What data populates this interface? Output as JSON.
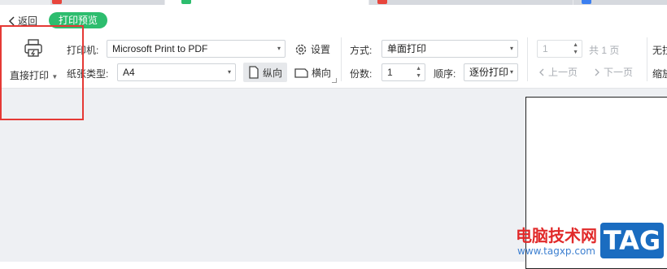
{
  "nav": {
    "back_label": "返回",
    "badge_label": "打印预览"
  },
  "ribbon": {
    "direct_print_label": "直接打印",
    "printer_label": "打印机:",
    "printer_value": "Microsoft Print to PDF",
    "settings_label": "设置",
    "paper_type_label": "纸张类型:",
    "paper_type_value": "A4",
    "portrait_label": "纵向",
    "landscape_label": "横向",
    "mode_label": "方式:",
    "mode_value": "单面打印",
    "copies_label": "份数:",
    "copies_value": "1",
    "order_label": "顺序:",
    "order_value": "逐份打印",
    "page_value": "1",
    "total_pages_label": "共 1 页",
    "prev_page_label": "上一页",
    "next_page_label": "下一页",
    "right_label_top": "无拉",
    "right_label_bottom": "缩放"
  },
  "watermark": {
    "site_text": "电脑技术网",
    "url": "www.tagxp.com",
    "tag": "TAG"
  },
  "colors": {
    "accent_green": "#2dbd6e",
    "highlight_red": "#e53935",
    "canvas_bg": "#eef0f3"
  }
}
